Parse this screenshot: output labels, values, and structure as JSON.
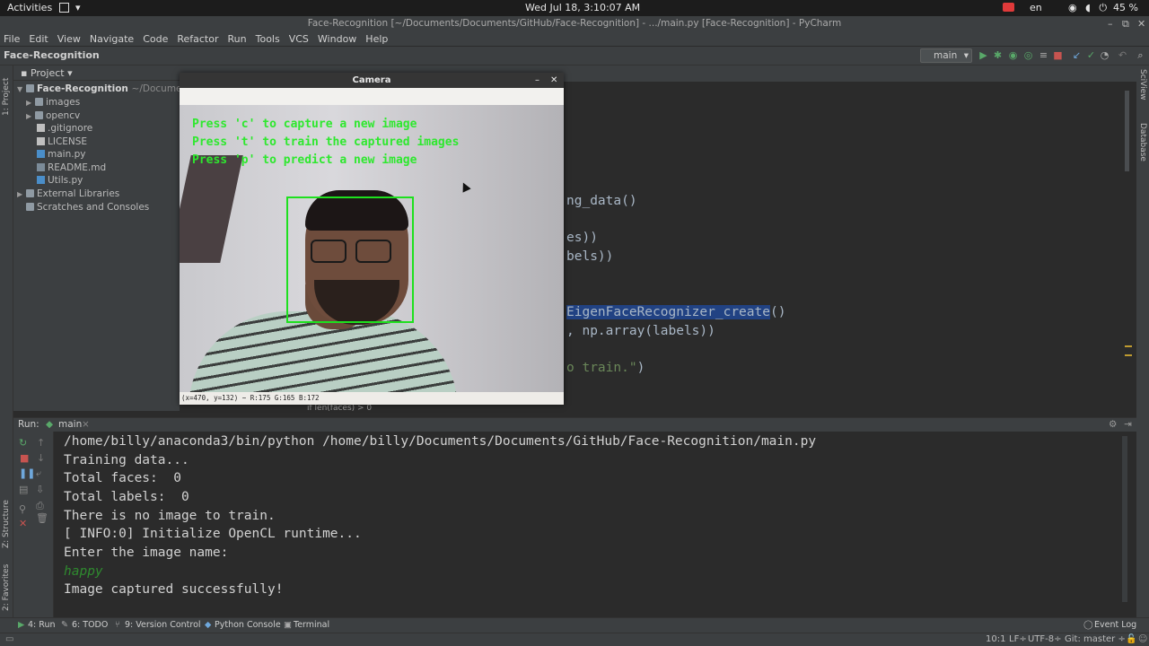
{
  "topbar": {
    "activities": "Activities",
    "clock": "Wed Jul 18,  3:10:07 AM",
    "language": "en",
    "battery": "45 %"
  },
  "window": {
    "title": "Face-Recognition [~/Documents/Documents/GitHub/Face-Recognition] - .../main.py [Face-Recognition] - PyCharm"
  },
  "menu": [
    "File",
    "Edit",
    "View",
    "Navigate",
    "Code",
    "Refactor",
    "Run",
    "Tools",
    "VCS",
    "Window",
    "Help"
  ],
  "navbar": {
    "breadcrumb": "Face-Recognition",
    "run_config": "main"
  },
  "project": {
    "header": "Project",
    "root": "Face-Recognition",
    "root_path": "~/Documents/D",
    "items": [
      {
        "label": "images",
        "type": "folder"
      },
      {
        "label": "opencv",
        "type": "folder"
      },
      {
        "label": ".gitignore",
        "type": "file"
      },
      {
        "label": "LICENSE",
        "type": "file"
      },
      {
        "label": "main.py",
        "type": "py"
      },
      {
        "label": "README.md",
        "type": "md"
      },
      {
        "label": "Utils.py",
        "type": "py"
      }
    ],
    "external": "External Libraries",
    "scratches": "Scratches and Consoles"
  },
  "sidebar_labels": {
    "project": "1: Project",
    "structure": "Z: Structure",
    "favorites": "2: Favorites",
    "sciview": "SciView",
    "database": "Database"
  },
  "editor": {
    "lines": [
      {
        "text": "ng_data()"
      },
      {
        "text": "es))"
      },
      {
        "text": "bels))"
      },
      {
        "pre": "",
        "hl": "EigenFaceRecognizer_create",
        "post": "()"
      },
      {
        "text": ", np.array(labels))"
      },
      {
        "str": "o train.\"",
        "post": ")"
      }
    ],
    "breadcrumb_hint": "if len(faces) > 0"
  },
  "camera": {
    "title": "Camera",
    "overlay": [
      "Press 'c' to capture a new image",
      "Press 't' to train the captured images",
      "Press 'p' to predict a new image"
    ],
    "status": "(x=470, y=132) ~ R:175 G:165 B:172"
  },
  "run": {
    "label": "Run:",
    "tab": "main",
    "console": [
      {
        "text": "/home/billy/anaconda3/bin/python /home/billy/Documents/Documents/GitHub/Face-Recognition/main.py",
        "kind": "out"
      },
      {
        "text": "Training data...",
        "kind": "out"
      },
      {
        "text": "Total faces:  0",
        "kind": "out"
      },
      {
        "text": "Total labels:  0",
        "kind": "out"
      },
      {
        "text": "There is no image to train.",
        "kind": "out"
      },
      {
        "text": "[ INFO:0] Initialize OpenCL runtime...",
        "kind": "out"
      },
      {
        "text": "Enter the image name:",
        "kind": "out"
      },
      {
        "text": "happy",
        "kind": "input"
      },
      {
        "text": "Image captured successfully!",
        "kind": "out"
      }
    ]
  },
  "toolwindows": {
    "run": "4: Run",
    "todo": "6: TODO",
    "vcs": "9: Version Control",
    "python_console": "Python Console",
    "terminal": "Terminal",
    "event_log": "Event Log"
  },
  "status": {
    "position": "10:1",
    "line_sep": "LF÷",
    "encoding": "UTF-8÷",
    "git": "Git: master ÷"
  },
  "colors": {
    "bg": "#2b2b2b",
    "panel": "#3c3f41",
    "accent_green": "#2ee82e",
    "selection": "#214283"
  }
}
